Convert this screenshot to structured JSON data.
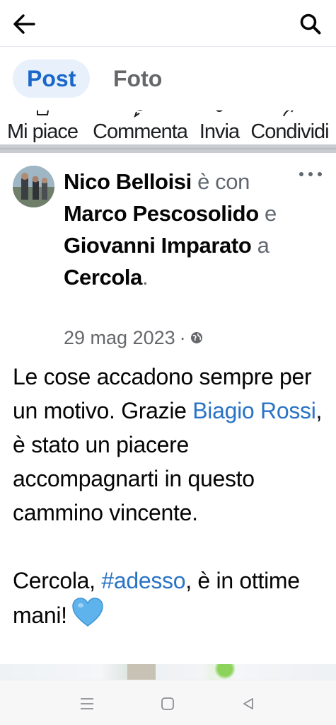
{
  "topbar": {
    "back_icon": "arrow-left-icon",
    "search_icon": "search-icon"
  },
  "tabs": [
    {
      "label": "Post",
      "active": true
    },
    {
      "label": "Foto",
      "active": false
    }
  ],
  "actions": [
    {
      "label": "Mi piace",
      "icon": "like-icon"
    },
    {
      "label": "Commenta",
      "icon": "comment-icon"
    },
    {
      "label": "Invia",
      "icon": "messenger-icon"
    },
    {
      "label": "Condividi",
      "icon": "share-icon"
    }
  ],
  "post": {
    "author": "Nico Belloisi",
    "with_text": "è con",
    "tagged_1": "Marco Pescosolido",
    "and_text": "e",
    "tagged_2": "Giovanni Imparato",
    "at_text": "a",
    "location": "Cercola",
    "period": ".",
    "date": "29 mag 2023",
    "separator": "·",
    "privacy_icon": "globe-icon",
    "more_icon": "more-options-icon",
    "text_1": "Le cose accadono sempre per un motivo. Grazie ",
    "mention": "Biagio Rossi",
    "text_2": ", è stato un piacere accompagnarti in questo cammino vincente.",
    "text_3": "Cercola, ",
    "hashtag": "#adesso",
    "text_4": ", è in ottime mani!",
    "emoji_icon": "blue-heart-icon"
  },
  "navbar": {
    "recents_icon": "recents-icon",
    "home_icon": "home-icon",
    "back_icon": "back-triangle-icon"
  },
  "colors": {
    "accent": "#1967c9",
    "tab_active_bg": "#e7f0fb",
    "link": "#2a73c5",
    "heart": "#5fb3ec"
  }
}
